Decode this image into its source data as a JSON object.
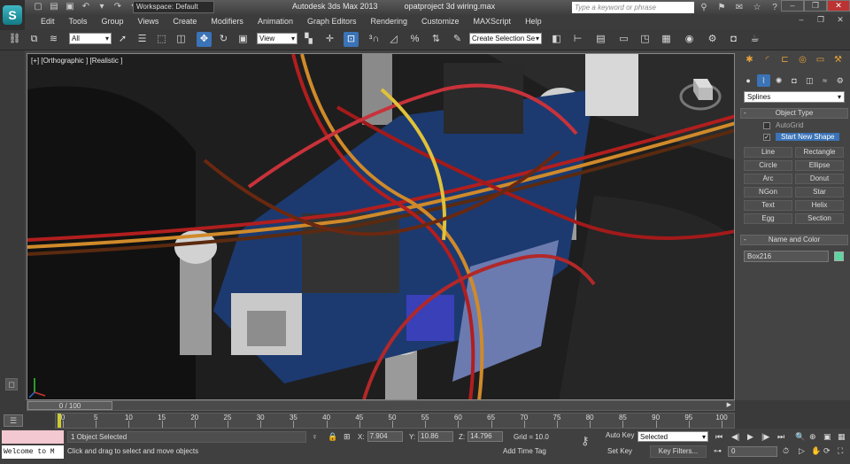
{
  "app": {
    "title": "Autodesk 3ds Max  2013",
    "file": "opatproject 3d wiring.max",
    "logo": "S",
    "workspace": "Workspace: Default",
    "search_placeholder": "Type a keyword or phrase"
  },
  "menu": [
    "Edit",
    "Tools",
    "Group",
    "Views",
    "Create",
    "Modifiers",
    "Animation",
    "Graph Editors",
    "Rendering",
    "Customize",
    "MAXScript",
    "Help"
  ],
  "toolbar": {
    "filter": "All",
    "ref_coord": "View",
    "selection_set": "Create Selection Se"
  },
  "viewport": {
    "label": "[+] [Orthographic ] [Realistic ]"
  },
  "command_panel": {
    "category": "Splines",
    "object_type_header": "Object Type",
    "autogrid": "AutoGrid",
    "start_new_shape": "Start New Shape",
    "start_new_shape_check": "✓",
    "buttons": [
      "Line",
      "Rectangle",
      "Circle",
      "Ellipse",
      "Arc",
      "Donut",
      "NGon",
      "Star",
      "Text",
      "Helix",
      "Egg",
      "Section"
    ],
    "name_color_header": "Name and Color",
    "object_name": "Box216",
    "color": "#5ed6a0"
  },
  "timeline": {
    "slider": "0 / 100",
    "ticks": [
      "0",
      "5",
      "10",
      "15",
      "20",
      "25",
      "30",
      "35",
      "40",
      "45",
      "50",
      "55",
      "60",
      "65",
      "70",
      "75",
      "80",
      "85",
      "90",
      "95",
      "100"
    ]
  },
  "status": {
    "selection": "1 Object Selected",
    "prompt": "Click and drag to select and move objects",
    "welcome": "Welcome to M",
    "x": "7.904",
    "y": "10.86",
    "z": "14.796",
    "grid": "Grid = 10.0",
    "add_time_tag": "Add Time Tag",
    "auto_key": "Auto Key",
    "set_key": "Set Key",
    "selected": "Selected",
    "key_filters": "Key Filters...",
    "frame": "0"
  }
}
